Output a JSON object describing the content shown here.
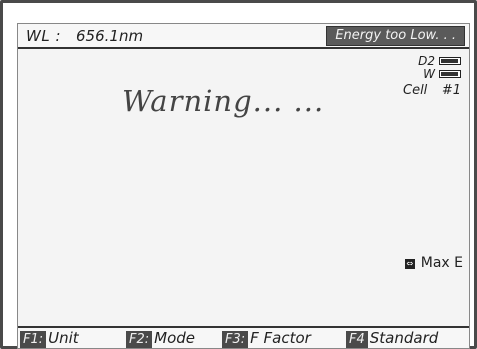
{
  "header": {
    "wl_label": "WL :",
    "wl_value": "656.1nm",
    "status": "Energy too Low. . ."
  },
  "main": {
    "message": "Warning... ..."
  },
  "indicators": {
    "d2_label": "D2",
    "d2_level": 0.95,
    "w_label": "W",
    "w_level": 0.95,
    "cell_label": "Cell",
    "cell_value": "#1"
  },
  "side": {
    "max_e_label": "Max  E",
    "max_e_icon": "toggle-icon"
  },
  "function_keys": [
    {
      "key": "F1:",
      "label": "Unit"
    },
    {
      "key": "F2:",
      "label": "Mode"
    },
    {
      "key": "F3:",
      "label": "F  Factor"
    },
    {
      "key": "F4",
      "label": "Standard"
    }
  ],
  "colors": {
    "status_bg": "#5a5a5a",
    "key_bg": "#4a4a4a",
    "screen_bg": "#f4f4f4"
  }
}
